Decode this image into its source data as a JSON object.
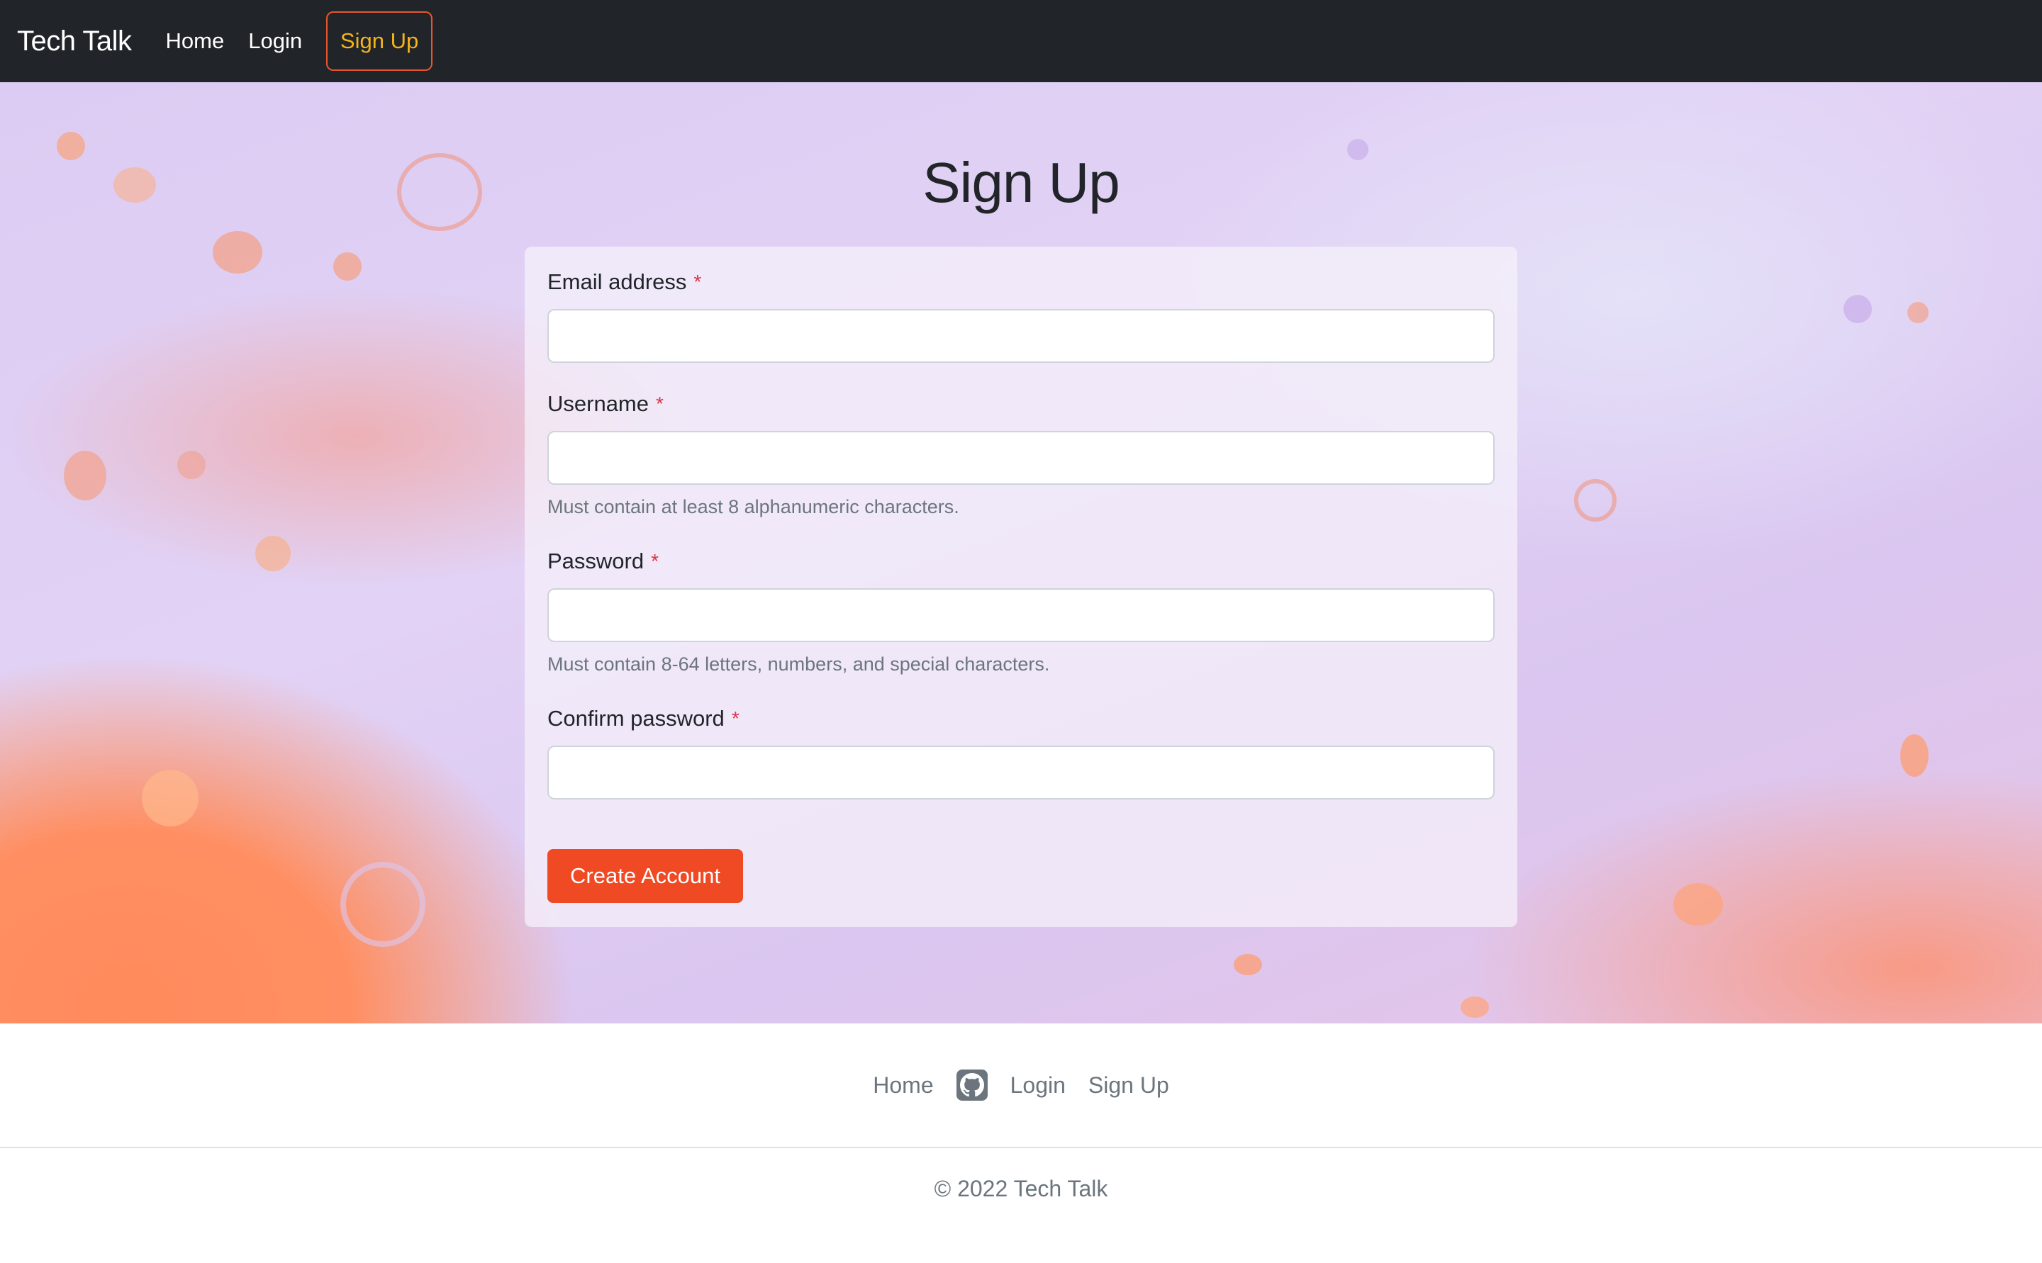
{
  "navbar": {
    "brand": "Tech Talk",
    "links": [
      {
        "label": "Home"
      },
      {
        "label": "Login"
      }
    ],
    "signup_label": "Sign Up"
  },
  "page": {
    "title": "Sign Up"
  },
  "form": {
    "required_marker": "*",
    "email_label": "Email address",
    "email_value": "",
    "username_label": "Username",
    "username_value": "",
    "username_help": "Must contain at least 8 alphanumeric characters.",
    "password_label": "Password",
    "password_value": "",
    "password_help": "Must contain 8-64 letters, numbers, and special characters.",
    "confirm_label": "Confirm password",
    "confirm_value": "",
    "submit_label": "Create Account"
  },
  "footer": {
    "links": [
      {
        "label": "Home"
      },
      {
        "label": "Login"
      },
      {
        "label": "Sign Up"
      }
    ],
    "github_icon": "github-icon",
    "copyright": "© 2022 Tech Talk"
  },
  "colors": {
    "navbar_bg": "#212529",
    "signup_text": "#f5b31b",
    "signup_border": "#e8562e",
    "accent_button": "#ef4a24",
    "required": "#dc3545",
    "muted_text": "#6c757d"
  }
}
